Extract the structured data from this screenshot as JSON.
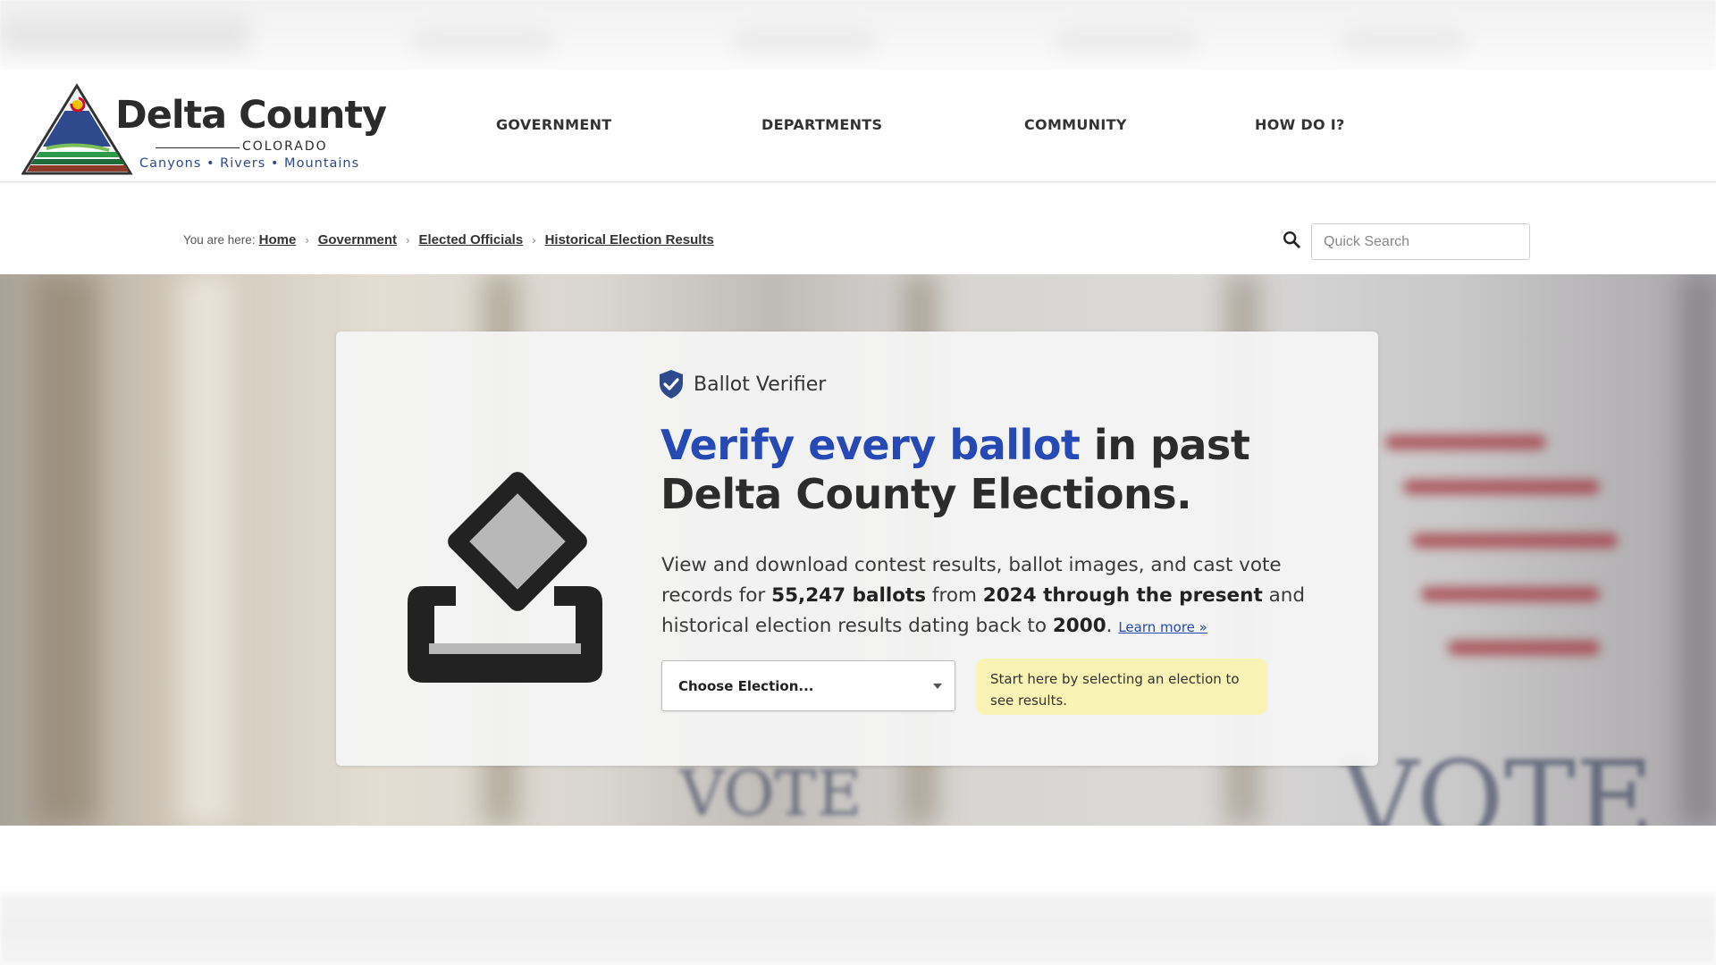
{
  "site": {
    "logo_title": "Delta County",
    "logo_state": "COLORADO",
    "logo_tagline": "Canyons • Rivers • Mountains"
  },
  "nav": {
    "items": [
      {
        "label": "GOVERNMENT"
      },
      {
        "label": "DEPARTMENTS"
      },
      {
        "label": "COMMUNITY"
      },
      {
        "label": "HOW DO I?"
      }
    ]
  },
  "breadcrumb": {
    "prefix": "You are here:",
    "items": [
      "Home",
      "Government",
      "Elected Officials",
      "Historical Election Results"
    ],
    "separator": "›"
  },
  "search": {
    "placeholder": "Quick Search",
    "icon": "search-icon"
  },
  "hero": {
    "badge_label": "Ballot Verifier",
    "badge_icon": "shield-check-icon",
    "headline_accent": "Verify every ballot",
    "headline_rest": " in past Delta County Elections.",
    "desc_1": "View and download contest results, ballot images, and cast vote records for ",
    "desc_ballots": "55,247 ballots",
    "desc_2": " from ",
    "desc_range": "2024 through the present",
    "desc_3": " and historical election results dating back to ",
    "desc_year": "2000",
    "desc_4": ".",
    "learn_more": "Learn more »",
    "select_value": "Choose Election...",
    "tip_text": "Start here by selecting an election to see results.",
    "illustration_icon": "ballot-box-icon"
  },
  "colors": {
    "accent": "#2649b5",
    "tip_bg": "#f9f3b5",
    "text": "#2c2c2c"
  }
}
